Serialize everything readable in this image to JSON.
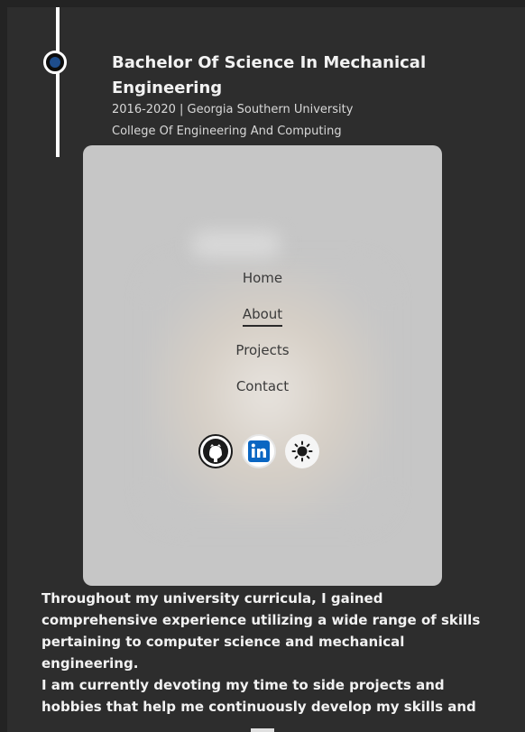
{
  "education": {
    "degree": "Bachelor Of Science In Mechanical Engineering",
    "years_school": "2016-2020 | Georgia Southern University",
    "college": "College Of Engineering And Computing"
  },
  "nav": {
    "items": [
      {
        "label": "Home"
      },
      {
        "label": "About",
        "active": true
      },
      {
        "label": "Projects"
      },
      {
        "label": "Contact"
      }
    ]
  },
  "social": {
    "icons": [
      "github-icon",
      "linkedin-icon",
      "sun-icon"
    ]
  },
  "about": {
    "para1": "Throughout my university curricula, I gained comprehensive experience utilizing a wide range of skills pertaining to computer science and mechanical engineering.",
    "para2_visible": "I am currently devoting my time to side projects and hobbies that help me continuously develop my skills and"
  },
  "colors": {
    "background": "#2d2d2d",
    "overlay": "#c6c6c6",
    "timeline_dot": "#1e4d8c",
    "linkedin": "#0a66c2"
  }
}
